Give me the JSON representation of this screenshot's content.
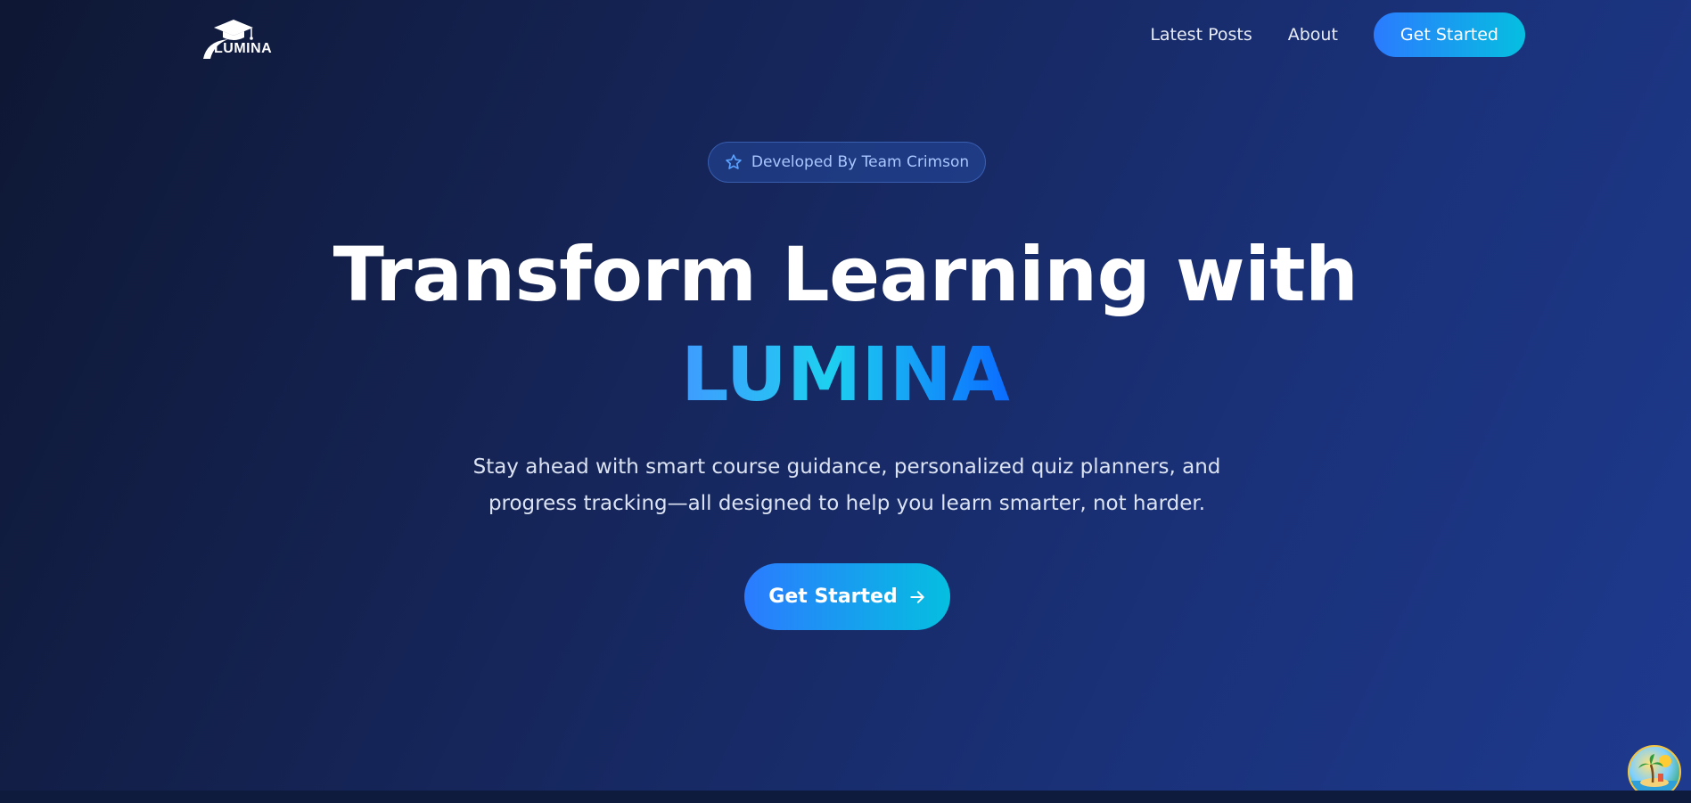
{
  "header": {
    "logo_text": "LUMINA",
    "nav": {
      "latest_posts": "Latest Posts",
      "about": "About",
      "get_started": "Get Started"
    }
  },
  "hero": {
    "badge": {
      "icon": "star-icon",
      "text": "Developed By Team Crimson"
    },
    "headline": "Transform Learning with",
    "brand": "LUMINA",
    "subtitle_line1": "Stay ahead with smart course guidance, personalized quiz planners, and",
    "subtitle_line2": "progress tracking—all designed to help you learn smarter, not harder.",
    "cta": {
      "label": "Get Started",
      "icon": "arrow-right-icon"
    }
  },
  "corner_widget": {
    "icon": "beach-island-icon"
  },
  "colors": {
    "accent_start": "#2b7bff",
    "accent_end": "#05bfe0",
    "background_dark": "#0e1733",
    "background_light": "#1e3a8e",
    "badge_text": "#a9c6ff"
  }
}
